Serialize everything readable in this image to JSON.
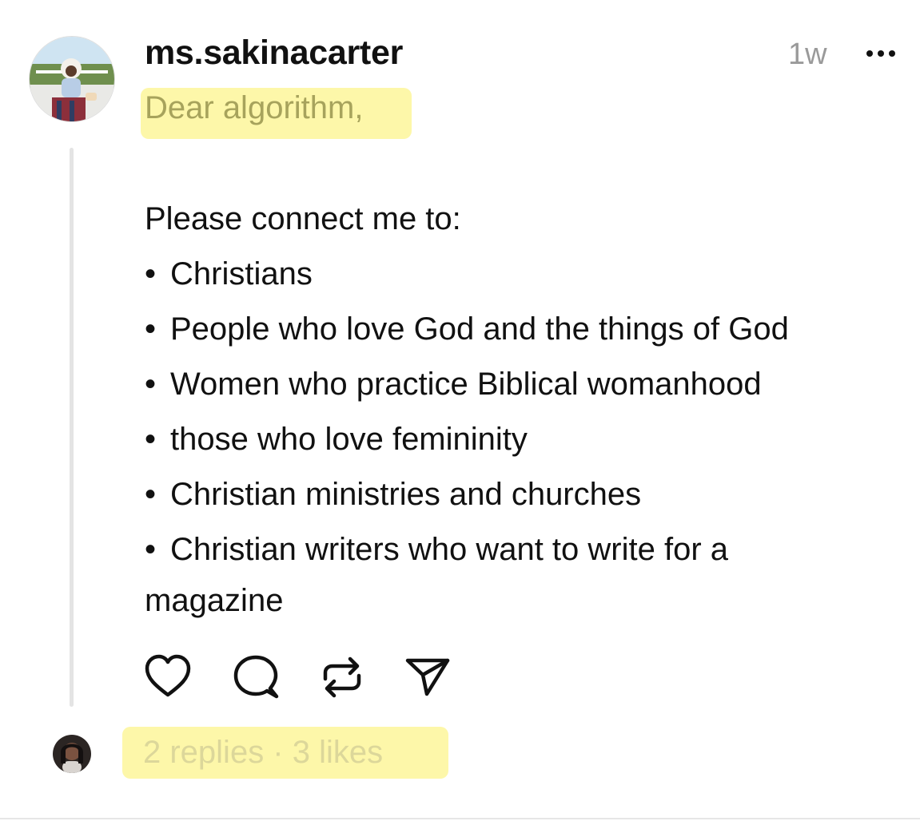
{
  "post": {
    "username": "ms.sakinacarter",
    "time": "1w",
    "greeting": "Dear algorithm,",
    "intro": "Please connect me to:",
    "bullet_symbol": "•",
    "bullets": [
      "Christians",
      "People who love God and the things of God",
      "Women who practice Biblical womanhood",
      "those who love femininity",
      "Christian ministries and churches",
      "Christian writers who want to write for a"
    ],
    "bullet_continuation": "magazine",
    "stats": "2 replies · 3 likes"
  },
  "icons": {
    "more": "ellipsis-icon",
    "like": "heart-icon",
    "comment": "comment-bubble-icon",
    "repost": "repost-icon",
    "share": "send-icon"
  },
  "colors": {
    "highlight": "#fdf7a9",
    "greeting_text": "#a7a35c",
    "stats_text": "#dcd79a",
    "timestamp": "#9a9a9a",
    "thread_line": "#e4e4e4"
  }
}
